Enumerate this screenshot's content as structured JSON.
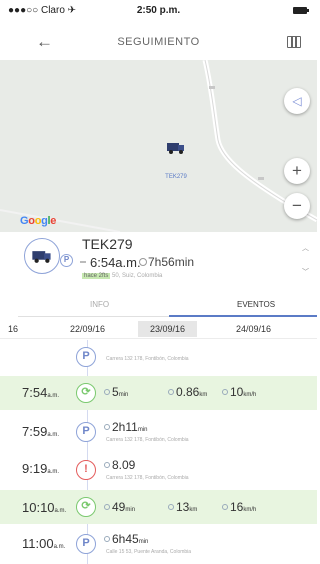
{
  "status_bar": {
    "carrier": "●●●○○ Claro ✈",
    "time": "2:50 p.m."
  },
  "nav": {
    "title": "SEGUIMIENTO",
    "back_icon": "arrow-left-icon",
    "map_icon": "map-icon"
  },
  "map": {
    "vehicle_label": "TEK279",
    "google_logo": "Google",
    "zoom_in": "+",
    "zoom_out": "−",
    "locate": "◁"
  },
  "summary": {
    "plate": "TEK279",
    "time_start": "6:54a.m.",
    "time_duration": "7h56min",
    "tag": "hace 2fts",
    "address": "50, Suiz, Colombia"
  },
  "tabs": {
    "info": "INFO",
    "events": "EVENTOS",
    "active": "EVENTOS"
  },
  "dates": [
    "16",
    "22/09/16",
    "23/09/16",
    "24/09/16"
  ],
  "selected_date": "23/09/16",
  "events": [
    {
      "time": "",
      "icon": "P",
      "type": "parking",
      "address": "Carrera 132 178, Fontibón, Colombia"
    },
    {
      "time": "7:54",
      "ampm": "a.m.",
      "icon": "⟳",
      "type": "moving",
      "duration": "5",
      "dur_unit": "min",
      "distance": "0.86",
      "dist_unit": "km",
      "speed": "10",
      "speed_unit": "km/h"
    },
    {
      "time": "7:59",
      "ampm": "a.m.",
      "icon": "P",
      "type": "parking",
      "duration": "2h11",
      "dur_unit": "min",
      "address": "Carrera 132 178, Fontibón, Colombia"
    },
    {
      "time": "9:19",
      "ampm": "a.m.",
      "icon": "!",
      "type": "alert",
      "duration": "8.09",
      "dur_unit": "",
      "address": "Carrera 132 178, Fontibón, Colombia"
    },
    {
      "time": "10:10",
      "ampm": "a.m.",
      "icon": "⟳",
      "type": "moving",
      "duration": "49",
      "dur_unit": "min",
      "distance": "13",
      "dist_unit": "km",
      "speed": "16",
      "speed_unit": "km/h"
    },
    {
      "time": "11:00",
      "ampm": "a.m.",
      "icon": "P",
      "type": "parking",
      "duration": "6h45",
      "dur_unit": "min",
      "address": "Calle 15 53, Puente Aranda, Colombia"
    }
  ],
  "colors": {
    "accent": "#5b7bc6",
    "moving_bg": "#e8f5e0",
    "alert": "#e45c5c",
    "moving": "#7bc96f"
  }
}
